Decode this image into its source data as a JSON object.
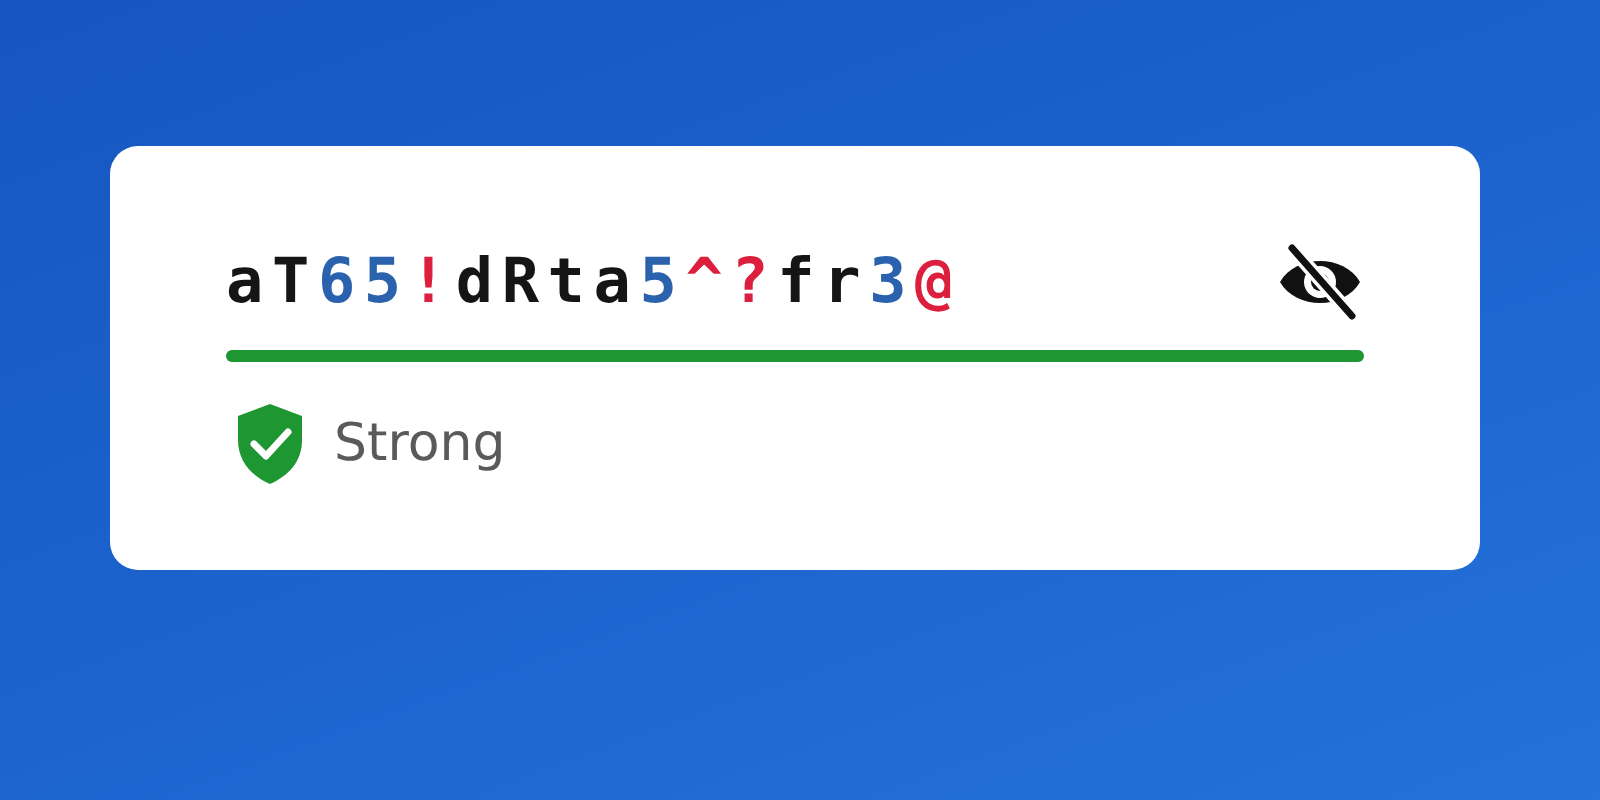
{
  "password": {
    "value": "aT65!dRta5^?fr3@",
    "visible": true
  },
  "strength": {
    "label": "Strong",
    "level": 1,
    "color": "#1e9631"
  }
}
